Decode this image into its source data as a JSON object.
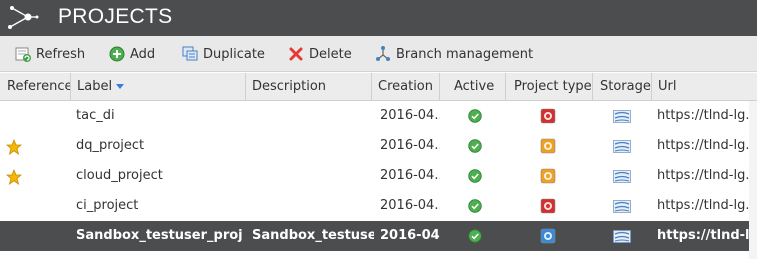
{
  "app": {
    "title": "PROJECTS",
    "logo_icon": "network-logo-icon"
  },
  "toolbar": {
    "refresh_label": "Refresh",
    "add_label": "Add",
    "duplicate_label": "Duplicate",
    "delete_label": "Delete",
    "branch_label": "Branch management"
  },
  "columns": {
    "reference": "Reference",
    "label": "Label",
    "description": "Description",
    "creation": "Creation",
    "active": "Active",
    "project_type": "Project type",
    "storage": "Storage",
    "url": "Url"
  },
  "rows": [
    {
      "reference": false,
      "label": "tac_di",
      "description": "",
      "creation": "2016-04...",
      "active": true,
      "project_type": "di",
      "url": "https://tlnd-lg..."
    },
    {
      "reference": true,
      "label": "dq_project",
      "description": "",
      "creation": "2016-04...",
      "active": true,
      "project_type": "dq",
      "url": "https://tlnd-lg..."
    },
    {
      "reference": true,
      "label": "cloud_project",
      "description": "",
      "creation": "2016-04...",
      "active": true,
      "project_type": "dq",
      "url": "https://tlnd-lg..."
    },
    {
      "reference": false,
      "label": "ci_project",
      "description": "",
      "creation": "2016-04...",
      "active": true,
      "project_type": "di",
      "url": "https://tlnd-lg..."
    },
    {
      "reference": false,
      "label": "Sandbox_testuser_project",
      "description": "Sandbox_testuser_...",
      "creation": "2016-04...",
      "active": true,
      "project_type": "sandbox",
      "url": "https://tlnd-lg...",
      "selected": true
    }
  ],
  "colors": {
    "titlebar_bg": "#4b4d4f",
    "selected_row_bg": "#4b4d4f",
    "active_green": "#4caf50",
    "type_red": "#d32f2f",
    "type_orange": "#f0a020",
    "storage_blue": "#4a7fc0"
  }
}
